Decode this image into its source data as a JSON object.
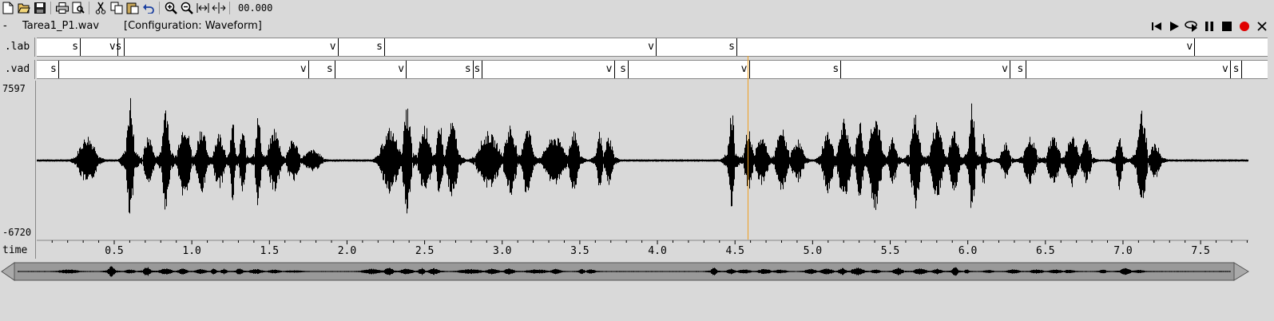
{
  "toolbar": {
    "buttons": [
      "new-file-icon",
      "open-folder-icon",
      "save-icon",
      "print-icon",
      "print-preview-icon",
      "cut-icon",
      "copy-icon",
      "paste-icon",
      "undo-icon",
      "zoom-in-icon",
      "zoom-out-icon",
      "zoom-fit-icon",
      "zoom-selection-icon"
    ],
    "time": "00.000"
  },
  "file": {
    "dash": "-",
    "name": "Tarea1_P1.wav",
    "config": "[Configuration: Waveform]"
  },
  "player": {
    "buttons": [
      "skip-start-icon",
      "play-icon",
      "loop-play-icon",
      "pause-icon",
      "stop-icon",
      "record-icon",
      "close-icon"
    ],
    "record_color": "#e00000"
  },
  "tracks": {
    "lab": {
      "name": ".lab",
      "marks": [
        {
          "t": 0.28,
          "label": "s"
        },
        {
          "t": 0.52,
          "label": "v"
        },
        {
          "t": 0.56,
          "label": "s"
        },
        {
          "t": 1.94,
          "label": "v"
        },
        {
          "t": 2.24,
          "label": "s"
        },
        {
          "t": 3.99,
          "label": "v"
        },
        {
          "t": 4.51,
          "label": "s"
        },
        {
          "t": 7.46,
          "label": "v"
        }
      ]
    },
    "vad": {
      "name": ".vad",
      "marks": [
        {
          "t": 0.14,
          "label": "s"
        },
        {
          "t": 1.75,
          "label": "v"
        },
        {
          "t": 1.92,
          "label": "s"
        },
        {
          "t": 2.38,
          "label": "v"
        },
        {
          "t": 2.81,
          "label": "s"
        },
        {
          "t": 2.87,
          "label": "s"
        },
        {
          "t": 3.72,
          "label": "v"
        },
        {
          "t": 3.81,
          "label": "s"
        },
        {
          "t": 4.59,
          "label": "v"
        },
        {
          "t": 5.18,
          "label": "s"
        },
        {
          "t": 6.27,
          "label": "v"
        },
        {
          "t": 6.37,
          "label": "s"
        },
        {
          "t": 7.69,
          "label": "v"
        },
        {
          "t": 7.76,
          "label": "s"
        }
      ]
    }
  },
  "waveform": {
    "max_label": "7597",
    "min_label": "-6720",
    "color": "#000000",
    "cursor_time": 4.58,
    "cursor_color": "#f0a020",
    "time_range": [
      0.0,
      7.8
    ],
    "bursts": [
      [
        0.25,
        0.4,
        0.35
      ],
      [
        0.57,
        0.63,
        0.9
      ],
      [
        0.68,
        0.76,
        0.35
      ],
      [
        0.8,
        0.86,
        0.85
      ],
      [
        0.9,
        1.0,
        0.55
      ],
      [
        1.02,
        1.1,
        0.5
      ],
      [
        1.13,
        1.22,
        0.4
      ],
      [
        1.24,
        1.28,
        0.6
      ],
      [
        1.3,
        1.35,
        0.45
      ],
      [
        1.4,
        1.45,
        0.65
      ],
      [
        1.48,
        1.58,
        0.45
      ],
      [
        1.6,
        1.7,
        0.3
      ],
      [
        1.7,
        1.85,
        0.15
      ],
      [
        2.2,
        2.35,
        0.45
      ],
      [
        2.35,
        2.42,
        0.75
      ],
      [
        2.45,
        2.55,
        0.5
      ],
      [
        2.57,
        2.62,
        0.6
      ],
      [
        2.63,
        2.72,
        0.55
      ],
      [
        2.82,
        3.0,
        0.4
      ],
      [
        3.0,
        3.1,
        0.5
      ],
      [
        3.12,
        3.2,
        0.55
      ],
      [
        3.25,
        3.42,
        0.35
      ],
      [
        3.42,
        3.5,
        0.45
      ],
      [
        3.6,
        3.65,
        0.4
      ],
      [
        3.65,
        3.72,
        0.35
      ],
      [
        4.45,
        4.5,
        0.75
      ],
      [
        4.55,
        4.62,
        0.45
      ],
      [
        4.62,
        4.72,
        0.35
      ],
      [
        4.75,
        4.85,
        0.45
      ],
      [
        4.85,
        4.95,
        0.3
      ],
      [
        5.05,
        5.14,
        0.45
      ],
      [
        5.15,
        5.25,
        0.55
      ],
      [
        5.27,
        5.33,
        0.6
      ],
      [
        5.35,
        5.45,
        0.7
      ],
      [
        5.48,
        5.55,
        0.35
      ],
      [
        5.62,
        5.7,
        0.65
      ],
      [
        5.75,
        5.85,
        0.55
      ],
      [
        5.87,
        5.95,
        0.45
      ],
      [
        6.0,
        6.05,
        0.85
      ],
      [
        6.08,
        6.12,
        0.35
      ],
      [
        6.2,
        6.28,
        0.25
      ],
      [
        6.35,
        6.45,
        0.35
      ],
      [
        6.5,
        6.6,
        0.35
      ],
      [
        6.62,
        6.72,
        0.35
      ],
      [
        6.72,
        6.8,
        0.3
      ],
      [
        6.95,
        7.0,
        0.4
      ],
      [
        7.08,
        7.16,
        0.7
      ],
      [
        7.16,
        7.25,
        0.25
      ]
    ]
  },
  "time_axis": {
    "label": "time",
    "ticks": [
      "0.5",
      "1.0",
      "1.5",
      "2.0",
      "2.5",
      "3.0",
      "3.5",
      "4.0",
      "4.5",
      "5.0",
      "5.5",
      "6.0",
      "6.5",
      "7.0",
      "7.5"
    ]
  },
  "scrollbar": {
    "left_arrow": "scroll-left-icon",
    "right_arrow": "scroll-right-icon"
  }
}
